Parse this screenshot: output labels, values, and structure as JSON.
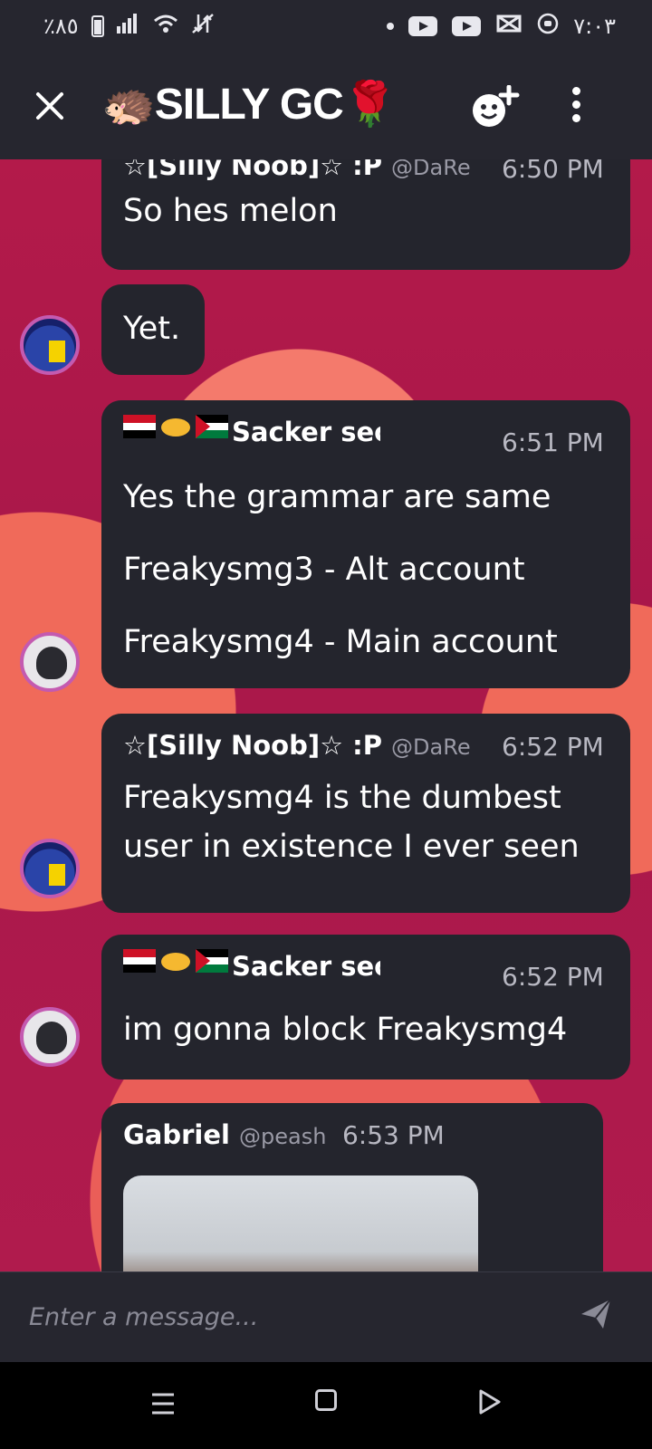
{
  "status_bar": {
    "battery": "٪٨٥",
    "time": "٧:٠٣"
  },
  "header": {
    "title": "🦔SILLY GC🌹"
  },
  "messages": [
    {
      "author": "☆[Silly Noob]☆ :P",
      "handle": "@DaRe",
      "time": "6:50 PM",
      "lines": [
        "So hes melon"
      ]
    },
    {
      "author": "",
      "handle": "",
      "time": "",
      "lines": [
        "Yet."
      ]
    },
    {
      "author": "Sacker sector bra",
      "flags": "🇮🇶🤝🇯🇴",
      "handle": "",
      "time": "6:51 PM",
      "lines": [
        "Yes the grammar are same",
        "Freakysmg3 - Alt account",
        "Freakysmg4 - Main account"
      ]
    },
    {
      "author": "☆[Silly Noob]☆ :P",
      "handle": "@DaRe",
      "time": "6:52 PM",
      "lines": [
        "Freakysmg4 is the dumbest",
        "user in existence I ever seen"
      ]
    },
    {
      "author": "Sacker sector bra",
      "flags": "🇮🇶🤝🇯🇴",
      "handle": "",
      "time": "6:52 PM",
      "lines": [
        "im gonna block Freakysmg4"
      ]
    },
    {
      "author": "Gabriel",
      "handle": "@peash",
      "time": "6:53 PM",
      "lines": []
    }
  ],
  "composer": {
    "placeholder": "Enter a message..."
  },
  "icons": {
    "close": "close-icon",
    "add_user": "add-user-icon",
    "more": "more-vertical-icon",
    "send": "send-icon"
  },
  "colors": {
    "header_bg": "#26262f",
    "bubble_bg": "#24252d",
    "chat_bg": "#b01b4d"
  }
}
